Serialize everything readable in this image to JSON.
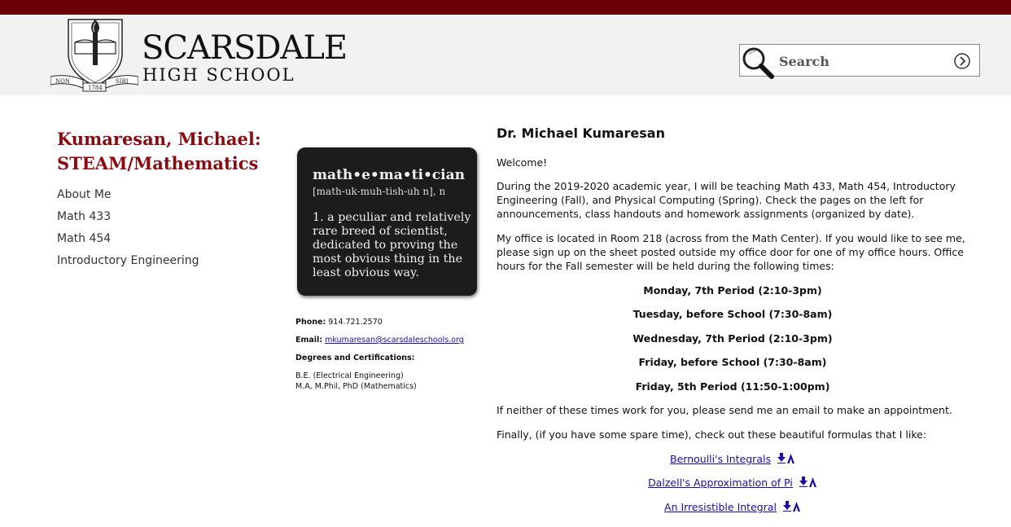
{
  "header": {
    "school_name": "SCARSDALE",
    "school_sub": "HIGH SCHOOL",
    "crest": {
      "left_motto": "NON",
      "year": "1784",
      "right_motto": "SIBI"
    },
    "search": {
      "placeholder": "Search"
    }
  },
  "sidebar": {
    "title": "Kumaresan, Michael: STEAM/Mathematics",
    "items": [
      {
        "label": "About Me"
      },
      {
        "label": "Math 433"
      },
      {
        "label": "Math 454"
      },
      {
        "label": "Introductory Engineering"
      }
    ]
  },
  "card": {
    "word": "math•e•ma•ti•cian",
    "pronunciation": "[math-uk-muh-tish-uh n], n",
    "definition": "1. a peculiar and relatively rare breed of scientist, dedicated to proving the most obvious thing in the least obvious way."
  },
  "contact": {
    "phone_label": "Phone:",
    "phone": "914.721.2570",
    "email_label": "Email:",
    "email": "mkumaresan@scarsdaleschools.org",
    "degrees_label": "Degrees and Certifications:",
    "degree_1": "B.E. (Electrical Engineering)",
    "degree_2": "M.A, M.Phil, PhD (Mathematics)"
  },
  "main": {
    "heading": "Dr. Michael Kumaresan",
    "welcome": "Welcome!",
    "para_1": "During the 2019-2020 academic year, I will be teaching Math 433, Math 454, Introductory Engineering (Fall), and Physical Computing (Spring). Check the pages on the left for announcements, class handouts and homework assignments (organized by date).",
    "para_2": "My office is located in Room 218 (across from the Math Center). If you would like to see me, please sign up on the sheet posted outside my office door for one of my office hours. Office hours for the Fall semester will be held during the following times:",
    "hours": [
      "Monday, 7th Period (2:10-3pm)",
      "Tuesday, before School (7:30-8am)",
      "Wednesday, 7th Period (2:10-3pm)",
      "Friday, before School (7:30-8am)",
      "Friday, 5th Period (11:50-1:00pm)"
    ],
    "para_3": "If neither of these times work for you, please send me an email to make an appointment.",
    "para_4": "Finally, (if you have some spare time), check out these beautiful formulas that I like:",
    "links": [
      "Bernoulli's Integrals",
      "Dalzell's Approximation of Pi",
      "An Irresistible Integral"
    ]
  },
  "colors": {
    "top_bar": "#6b0006",
    "accent": "#8b0a11",
    "link": "#1a0dab",
    "header_bg": "#f2f2f2"
  }
}
